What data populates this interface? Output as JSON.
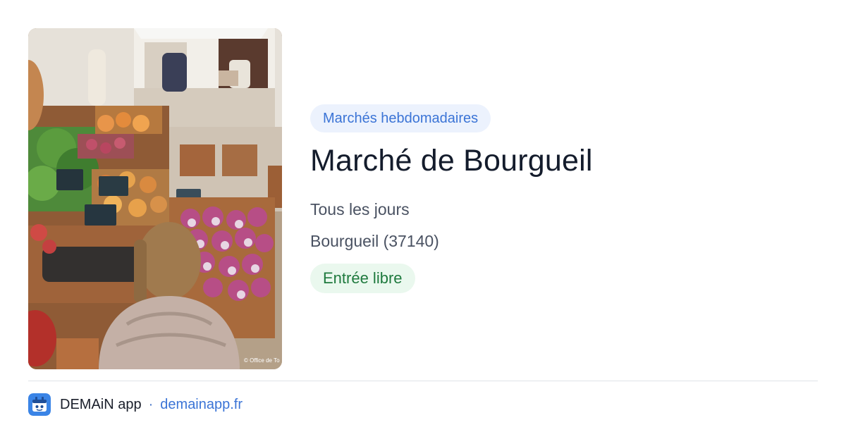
{
  "image": {
    "caption": "© Office de To"
  },
  "event": {
    "category": "Marchés hebdomadaires",
    "title": "Marché de Bourgueil",
    "schedule": "Tous les jours",
    "location": "Bourgueil (37140)",
    "price": "Entrée libre"
  },
  "footer": {
    "app_name": "DEMAiN app",
    "separator": "·",
    "site": "demainapp.fr"
  },
  "colors": {
    "category_badge_bg": "#ecf2fd",
    "category_badge_text": "#3b74d6",
    "price_badge_bg": "#eaf8ee",
    "price_badge_text": "#1f7a3e",
    "title_text": "#141c2c",
    "link": "#3b74d6"
  },
  "icons": {
    "app_logo": "demain-logo-icon"
  }
}
